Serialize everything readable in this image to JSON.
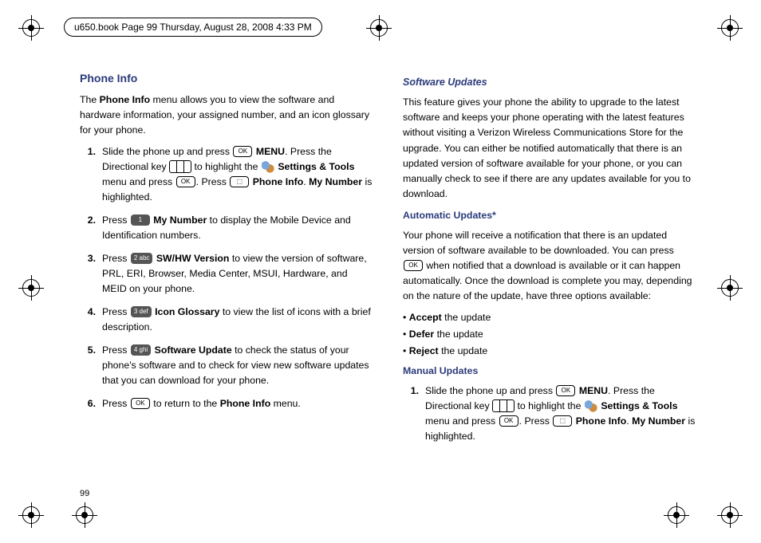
{
  "book_tag": "u650.book  Page 99  Thursday, August 28, 2008  4:33 PM",
  "left": {
    "heading": "Phone Info",
    "intro_a": "The ",
    "intro_b_bold": "Phone Info",
    "intro_c": " menu allows you to view the software and hardware information, your assigned number, and an icon glossary for your phone.",
    "steps": {
      "s1": {
        "n": "1.",
        "a": "Slide the phone up and press ",
        "ok": "OK",
        "b_bold": " MENU",
        "c": ". Press the Directional key ",
        "d": " to highlight the ",
        "e_bold": "Settings & Tools",
        "f": " menu and press ",
        "g": ". Press ",
        "h_bold": "Phone Info",
        "i": ". ",
        "j_bold": "My Number",
        "k": " is highlighted."
      },
      "s2": {
        "n": "2.",
        "a": "Press ",
        "key": "1",
        "b_bold": " My Number",
        "c": " to display the Mobile Device and Identification numbers."
      },
      "s3": {
        "n": "3.",
        "a": "Press ",
        "key": "2 abc",
        "b_bold": " SW/HW Version",
        "c": " to view the version of software, PRL, ERI, Browser, Media Center, MSUI, Hardware, and MEID on your phone."
      },
      "s4": {
        "n": "4.",
        "a": "Press ",
        "key": "3 def",
        "b_bold": " Icon Glossary",
        "c": " to view the list of icons with a brief description."
      },
      "s5": {
        "n": "5.",
        "a": "Press ",
        "key": "4 ghi",
        "b_bold": " Software Update",
        "c": " to check the status of your phone's software and to check for view new software updates that you can download for your phone."
      },
      "s6": {
        "n": "6.",
        "a": "Press ",
        "ok": "OK",
        "b": " to return to the ",
        "c_bold": "Phone Info",
        "d": " menu."
      }
    }
  },
  "right": {
    "sw_heading": "Software Updates",
    "sw_para": "This feature gives your phone the ability to upgrade to the latest software and keeps your phone operating with the latest features without visiting a Verizon Wireless Communications Store for the upgrade. You can either be notified automatically that there is an updated version of software available for your phone, or you can manually check to see if there are any updates available for you to download.",
    "auto_heading": "Automatic Updates*",
    "auto_a": "Your phone will receive a notification that there is an updated version of software available to be downloaded. You can press ",
    "auto_ok": "OK",
    "auto_b": " when notified that a download is available or it can happen automatically. Once the download is complete you may, depending on the nature of the update, have three options available:",
    "opts": {
      "o1a": "Accept",
      "o1b": " the update",
      "o2a": "Defer",
      "o2b": " the update",
      "o3a": "Reject",
      "o3b": " the update"
    },
    "manual_heading": "Manual Updates",
    "m1": {
      "n": "1.",
      "a": "Slide the phone up and press ",
      "ok": "OK",
      "b_bold": " MENU",
      "c": ". Press the Directional key ",
      "d": " to highlight the ",
      "e_bold": "Settings & Tools",
      "f": " menu and press ",
      "g": ". Press ",
      "h_bold": "Phone Info",
      "i": ". ",
      "j_bold": "My Number",
      "k": " is highlighted."
    }
  },
  "page_number": "99"
}
